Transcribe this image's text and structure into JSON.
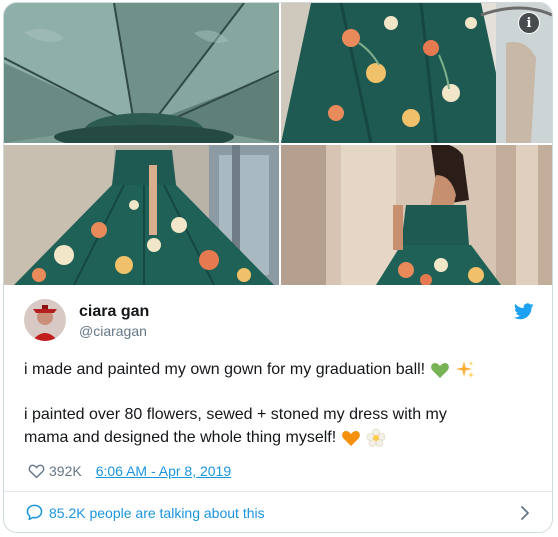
{
  "tweet": {
    "display_name": "ciara gan",
    "handle": "@ciaragan",
    "text_line_1": "i made and painted my own gown for my graduation ball!",
    "text_line_1_emojis": [
      "green-heart",
      "sparkles"
    ],
    "text_line_2": "i painted over 80 flowers, sewed + stoned my dress with my",
    "text_line_3": "mama and designed the whole thing myself!",
    "text_line_3_emojis": [
      "orange-heart",
      "blossom"
    ],
    "likes": "392K",
    "timestamp": "6:06 AM - Apr 8, 2019",
    "talking_text": "85.2K people are talking about this"
  },
  "media": {
    "photos": [
      {
        "name": "photo-dress-underside",
        "subject": "teal gown seen from underneath"
      },
      {
        "name": "photo-skirt-closeup",
        "subject": "painted floral skirt close-up"
      },
      {
        "name": "photo-full-gown",
        "subject": "full teal gown with painted flowers"
      },
      {
        "name": "photo-back-view",
        "subject": "wearer in strapless gown, back view"
      }
    ],
    "info_label": "i"
  },
  "icons": {
    "brand": "twitter-bird-icon",
    "like": "heart-outline-icon",
    "reply": "speech-bubble-icon",
    "more": "chevron-right-icon",
    "info": "info-icon"
  },
  "colors": {
    "link_blue": "#1b95e0",
    "text_dark": "#14171a",
    "text_gray": "#657786",
    "border": "#cfd9de",
    "gown_teal": "#1f5a52"
  }
}
